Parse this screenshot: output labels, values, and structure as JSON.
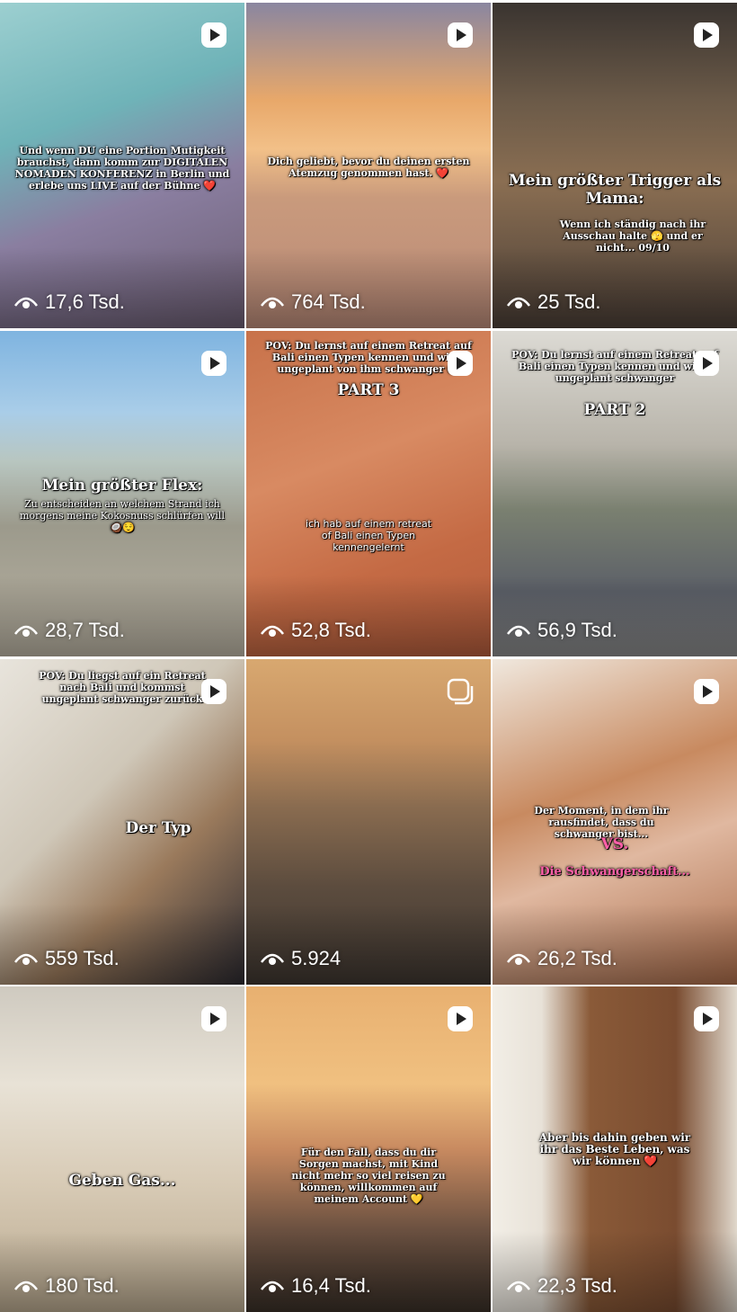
{
  "colors": {
    "overlay_text": "#ffffff",
    "pink_text": "#ff5fa8"
  },
  "posts": [
    {
      "views": "17,6 Tsd.",
      "caption": "Und wenn DU eine Portion Mutigkeit brauchst, dann komm zur DIGITALEN NOMADEN KONFERENZ in Berlin und erlebe uns LIVE auf der Bühne ❤️",
      "caption2": "",
      "badge": "reel-icon"
    },
    {
      "views": "764 Tsd.",
      "caption": "Dich geliebt, bevor du deinen ersten Atemzug genommen hast. ❤️",
      "caption2": "",
      "badge": "reel-icon"
    },
    {
      "views": "25 Tsd.",
      "caption": "Mein größter Trigger als Mama:",
      "caption2": "Wenn ich ständig nach ihr Ausschau halte 🫣 und er nicht... 09/10",
      "badge": "reel-icon"
    },
    {
      "views": "28,7 Tsd.",
      "caption": "Mein größter Flex:",
      "caption2": "Zu entscheiden an welchem Strand ich morgens meine Kokosnuss schlürfen will 🥥😌",
      "badge": "reel-icon"
    },
    {
      "views": "52,8 Tsd.",
      "caption": "POV: Du lernst auf einem Retreat auf Bali einen Typen kennen und wirst ungeplant von ihm schwanger 🫣",
      "caption2": "PART 3",
      "caption3": "ich hab auf einem retreat of Bali einen Typen kennengelernt",
      "badge": "reel-icon"
    },
    {
      "views": "56,9 Tsd.",
      "caption": "POV: Du lernst auf einem Retreat auf Bali einen Typen kennen und wirst ungeplant schwanger",
      "caption2": "PART 2",
      "badge": "reel-icon"
    },
    {
      "views": "559 Tsd.",
      "caption": "POV: Du liegst auf ein Retreat nach Bali und kommst ungeplant schwanger zurück",
      "caption2": "Der Typ",
      "badge": "reel-icon"
    },
    {
      "views": "5.924",
      "caption": "",
      "caption2": "",
      "badge": "carousel-icon"
    },
    {
      "views": "26,2 Tsd.",
      "caption": "Der Moment, in dem ihr rausfindet, dass du schwanger bist...",
      "caption2": "VS.",
      "caption3": "Die Schwangerschaft...",
      "badge": "reel-icon"
    },
    {
      "views": "180 Tsd.",
      "caption": "Geben Gas...",
      "caption2": "",
      "badge": "reel-icon"
    },
    {
      "views": "16,4 Tsd.",
      "caption": "Für den Fall, dass du dir Sorgen machst, mit Kind nicht mehr so viel reisen zu können, willkommen auf meinem Account 💛",
      "caption2": "",
      "badge": "reel-icon"
    },
    {
      "views": "22,3 Tsd.",
      "caption": "Aber bis dahin geben wir ihr das Beste Leben, was wir können ❤️",
      "caption2": "",
      "badge": "reel-icon"
    }
  ]
}
